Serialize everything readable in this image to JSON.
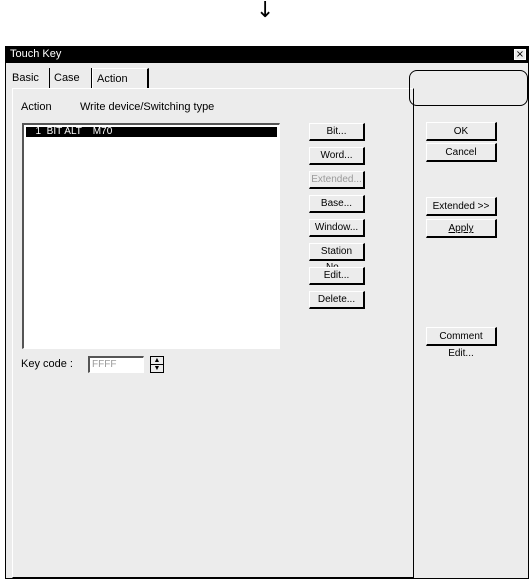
{
  "arrow": "↓",
  "window": {
    "title": "Touch Key",
    "close": "×"
  },
  "tabs": [
    {
      "label": "Basic"
    },
    {
      "label": "Case"
    },
    {
      "label": "Action"
    }
  ],
  "action": {
    "label": "Action",
    "type_label": "Write device/Switching type",
    "list": [
      "  1  BIT ALT    M70"
    ]
  },
  "side_buttons": {
    "bit": "Bit...",
    "word": "Word...",
    "extended": "Extended...",
    "base": "Base...",
    "window": "Window...",
    "station": "Station No...",
    "edit": "Edit...",
    "delete": "Delete..."
  },
  "keycode": {
    "label": "Key code :",
    "value": "FFFF"
  },
  "right_buttons": {
    "ok": "OK",
    "cancel": "Cancel",
    "extended": "Extended >>",
    "apply": "Apply",
    "comment": "Comment Edit..."
  }
}
